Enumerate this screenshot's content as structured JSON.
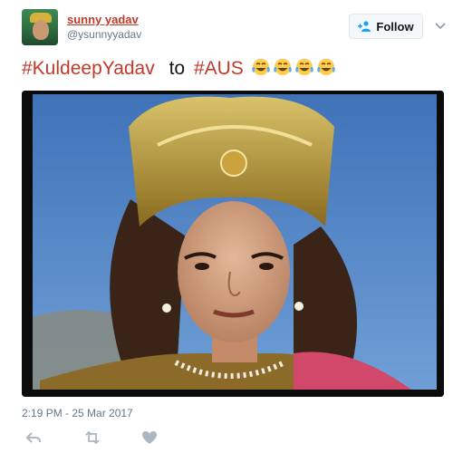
{
  "user": {
    "display_name": "sunny yadav",
    "handle": "@ysunnyyadav",
    "avatar_icon": "profile-avatar"
  },
  "follow_button": {
    "label": "Follow",
    "icon": "add-user-icon"
  },
  "caret_icon": "chevron-down-icon",
  "tweet": {
    "hashtag1": "#KuldeepYadav",
    "connector": "to",
    "hashtag2": "#AUS",
    "emoji": [
      "face-with-tears-of-joy",
      "face-with-tears-of-joy",
      "face-with-tears-of-joy",
      "face-with-tears-of-joy"
    ]
  },
  "media": {
    "type": "video-still"
  },
  "timestamp": "2:19 PM - 25 Mar 2017",
  "actions": [
    "reply-icon",
    "retweet-icon",
    "like-icon"
  ],
  "colors": {
    "hashtag": "#c0392b",
    "handle": "#657786",
    "follow_bg": "#f5f8fa",
    "action_icon": "#aab8c2"
  }
}
